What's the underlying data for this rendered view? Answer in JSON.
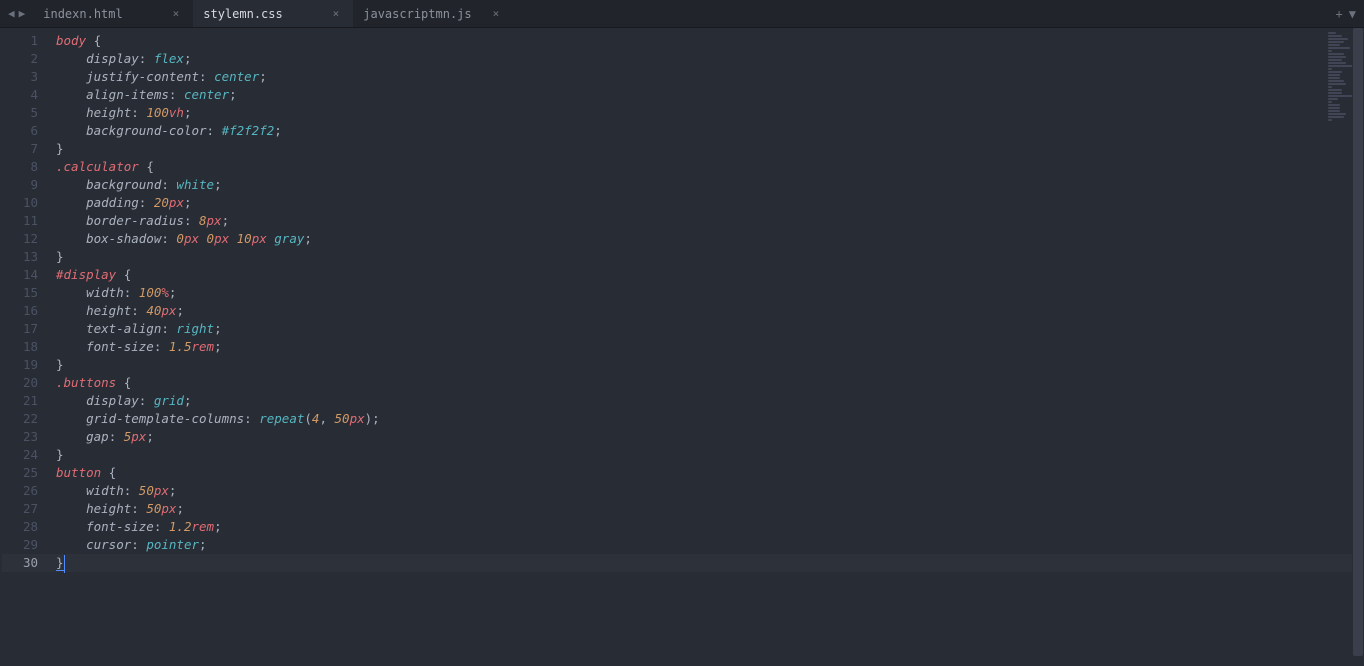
{
  "tabs": [
    {
      "label": "indexn.html",
      "active": false
    },
    {
      "label": "stylemn.css",
      "active": true
    },
    {
      "label": "javascriptmn.js",
      "active": false
    }
  ],
  "activeLine": 30,
  "lines": [
    [
      {
        "c": "tok-sel",
        "t": "body"
      },
      {
        "c": "tok-brace",
        "t": " {"
      }
    ],
    [
      {
        "c": "tok-prop",
        "t": "    display"
      },
      {
        "c": "tok-punc",
        "t": ": "
      },
      {
        "c": "tok-val",
        "t": "flex"
      },
      {
        "c": "tok-punc",
        "t": ";"
      }
    ],
    [
      {
        "c": "tok-prop",
        "t": "    justify-content"
      },
      {
        "c": "tok-punc",
        "t": ": "
      },
      {
        "c": "tok-val",
        "t": "center"
      },
      {
        "c": "tok-punc",
        "t": ";"
      }
    ],
    [
      {
        "c": "tok-prop",
        "t": "    align-items"
      },
      {
        "c": "tok-punc",
        "t": ": "
      },
      {
        "c": "tok-val",
        "t": "center"
      },
      {
        "c": "tok-punc",
        "t": ";"
      }
    ],
    [
      {
        "c": "tok-prop",
        "t": "    height"
      },
      {
        "c": "tok-punc",
        "t": ": "
      },
      {
        "c": "tok-num",
        "t": "100"
      },
      {
        "c": "tok-unit",
        "t": "vh"
      },
      {
        "c": "tok-punc",
        "t": ";"
      }
    ],
    [
      {
        "c": "tok-prop",
        "t": "    background-color"
      },
      {
        "c": "tok-punc",
        "t": ": "
      },
      {
        "c": "tok-val",
        "t": "#f2f2f2"
      },
      {
        "c": "tok-punc",
        "t": ";"
      }
    ],
    [
      {
        "c": "tok-brace",
        "t": "}"
      }
    ],
    [
      {
        "c": "tok-sel",
        "t": ".calculator"
      },
      {
        "c": "tok-brace",
        "t": " {"
      }
    ],
    [
      {
        "c": "tok-prop",
        "t": "    background"
      },
      {
        "c": "tok-punc",
        "t": ": "
      },
      {
        "c": "tok-val",
        "t": "white"
      },
      {
        "c": "tok-punc",
        "t": ";"
      }
    ],
    [
      {
        "c": "tok-prop",
        "t": "    padding"
      },
      {
        "c": "tok-punc",
        "t": ": "
      },
      {
        "c": "tok-num",
        "t": "20"
      },
      {
        "c": "tok-unit",
        "t": "px"
      },
      {
        "c": "tok-punc",
        "t": ";"
      }
    ],
    [
      {
        "c": "tok-prop",
        "t": "    border-radius"
      },
      {
        "c": "tok-punc",
        "t": ": "
      },
      {
        "c": "tok-num",
        "t": "8"
      },
      {
        "c": "tok-unit",
        "t": "px"
      },
      {
        "c": "tok-punc",
        "t": ";"
      }
    ],
    [
      {
        "c": "tok-prop",
        "t": "    box-shadow"
      },
      {
        "c": "tok-punc",
        "t": ": "
      },
      {
        "c": "tok-num",
        "t": "0"
      },
      {
        "c": "tok-unit",
        "t": "px "
      },
      {
        "c": "tok-num",
        "t": "0"
      },
      {
        "c": "tok-unit",
        "t": "px "
      },
      {
        "c": "tok-num",
        "t": "10"
      },
      {
        "c": "tok-unit",
        "t": "px "
      },
      {
        "c": "tok-val",
        "t": "gray"
      },
      {
        "c": "tok-punc",
        "t": ";"
      }
    ],
    [
      {
        "c": "tok-brace",
        "t": "}"
      }
    ],
    [
      {
        "c": "tok-sel",
        "t": "#display"
      },
      {
        "c": "tok-brace",
        "t": " {"
      }
    ],
    [
      {
        "c": "tok-prop",
        "t": "    width"
      },
      {
        "c": "tok-punc",
        "t": ": "
      },
      {
        "c": "tok-num",
        "t": "100"
      },
      {
        "c": "tok-unit",
        "t": "%"
      },
      {
        "c": "tok-punc",
        "t": ";"
      }
    ],
    [
      {
        "c": "tok-prop",
        "t": "    height"
      },
      {
        "c": "tok-punc",
        "t": ": "
      },
      {
        "c": "tok-num",
        "t": "40"
      },
      {
        "c": "tok-unit",
        "t": "px"
      },
      {
        "c": "tok-punc",
        "t": ";"
      }
    ],
    [
      {
        "c": "tok-prop",
        "t": "    text-align"
      },
      {
        "c": "tok-punc",
        "t": ": "
      },
      {
        "c": "tok-val",
        "t": "right"
      },
      {
        "c": "tok-punc",
        "t": ";"
      }
    ],
    [
      {
        "c": "tok-prop",
        "t": "    font-size"
      },
      {
        "c": "tok-punc",
        "t": ": "
      },
      {
        "c": "tok-num",
        "t": "1.5"
      },
      {
        "c": "tok-unit",
        "t": "rem"
      },
      {
        "c": "tok-punc",
        "t": ";"
      }
    ],
    [
      {
        "c": "tok-brace",
        "t": "}"
      }
    ],
    [
      {
        "c": "tok-sel",
        "t": ".buttons"
      },
      {
        "c": "tok-brace",
        "t": " {"
      }
    ],
    [
      {
        "c": "tok-prop",
        "t": "    display"
      },
      {
        "c": "tok-punc",
        "t": ": "
      },
      {
        "c": "tok-val",
        "t": "grid"
      },
      {
        "c": "tok-punc",
        "t": ";"
      }
    ],
    [
      {
        "c": "tok-prop",
        "t": "    grid-template-columns"
      },
      {
        "c": "tok-punc",
        "t": ": "
      },
      {
        "c": "tok-func",
        "t": "repeat"
      },
      {
        "c": "tok-punc",
        "t": "("
      },
      {
        "c": "tok-num",
        "t": "4"
      },
      {
        "c": "tok-punc",
        "t": ", "
      },
      {
        "c": "tok-num",
        "t": "50"
      },
      {
        "c": "tok-unit",
        "t": "px"
      },
      {
        "c": "tok-punc",
        "t": ");"
      }
    ],
    [
      {
        "c": "tok-prop",
        "t": "    gap"
      },
      {
        "c": "tok-punc",
        "t": ": "
      },
      {
        "c": "tok-num",
        "t": "5"
      },
      {
        "c": "tok-unit",
        "t": "px"
      },
      {
        "c": "tok-punc",
        "t": ";"
      }
    ],
    [
      {
        "c": "tok-brace",
        "t": "}"
      }
    ],
    [
      {
        "c": "tok-sel",
        "t": "button"
      },
      {
        "c": "tok-brace",
        "t": " {"
      }
    ],
    [
      {
        "c": "tok-prop",
        "t": "    width"
      },
      {
        "c": "tok-punc",
        "t": ": "
      },
      {
        "c": "tok-num",
        "t": "50"
      },
      {
        "c": "tok-unit",
        "t": "px"
      },
      {
        "c": "tok-punc",
        "t": ";"
      }
    ],
    [
      {
        "c": "tok-prop",
        "t": "    height"
      },
      {
        "c": "tok-punc",
        "t": ": "
      },
      {
        "c": "tok-num",
        "t": "50"
      },
      {
        "c": "tok-unit",
        "t": "px"
      },
      {
        "c": "tok-punc",
        "t": ";"
      }
    ],
    [
      {
        "c": "tok-prop",
        "t": "    font-size"
      },
      {
        "c": "tok-punc",
        "t": ": "
      },
      {
        "c": "tok-num",
        "t": "1.2"
      },
      {
        "c": "tok-unit",
        "t": "rem"
      },
      {
        "c": "tok-punc",
        "t": ";"
      }
    ],
    [
      {
        "c": "tok-prop",
        "t": "    cursor"
      },
      {
        "c": "tok-punc",
        "t": ": "
      },
      {
        "c": "tok-val",
        "t": "pointer"
      },
      {
        "c": "tok-punc",
        "t": ";"
      }
    ],
    [
      {
        "c": "tok-brace-hl",
        "t": "}"
      }
    ]
  ],
  "minimap": [
    8,
    14,
    20,
    16,
    12,
    22,
    4,
    16,
    18,
    14,
    18,
    26,
    4,
    14,
    12,
    12,
    16,
    18,
    4,
    14,
    14,
    28,
    10,
    4,
    12,
    12,
    12,
    18,
    16,
    4
  ]
}
